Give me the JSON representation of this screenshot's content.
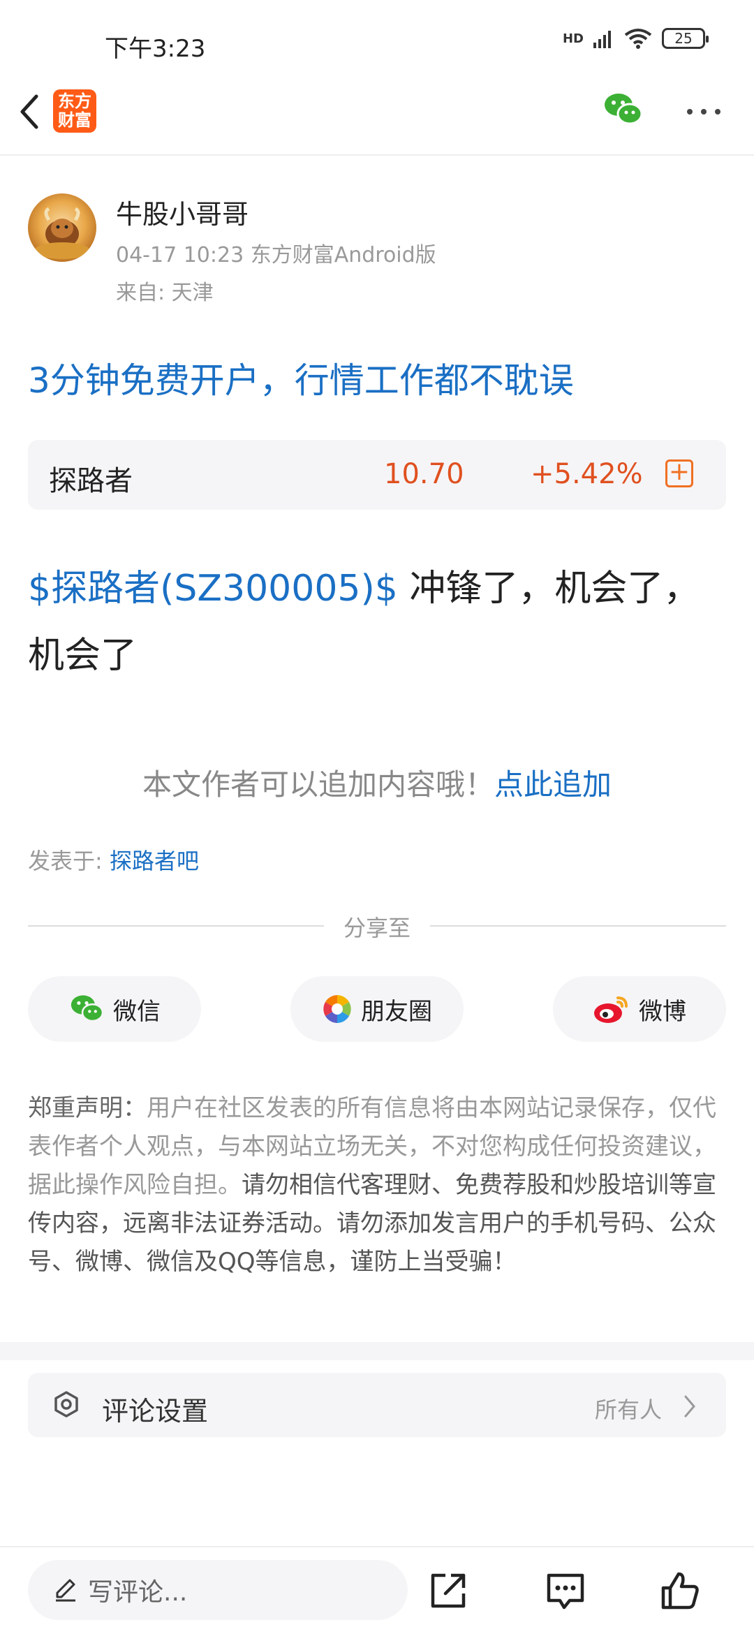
{
  "status_bar": {
    "time": "下午3:23",
    "network": "HD",
    "battery": "25"
  },
  "nav": {
    "logo_text": "东方财富"
  },
  "author": {
    "name": "牛股小哥哥",
    "meta": "04-17 10:23 东方财富Android版",
    "location": "来自: 天津"
  },
  "promo": {
    "text": "3分钟免费开户，行情工作都不耽误"
  },
  "stock_card": {
    "name": "探路者",
    "price": "10.70",
    "change": "+5.42%",
    "add_symbol": "+"
  },
  "post": {
    "tag": "$探路者(SZ300005)$",
    "text": " 冲锋了，机会了，机会了"
  },
  "append": {
    "prompt": "本文作者可以追加内容哦！",
    "link": "点此追加"
  },
  "posted_in": {
    "label": "发表于: ",
    "bar": "探路者吧"
  },
  "share": {
    "title": "分享至",
    "buttons": [
      {
        "label": "微信",
        "icon": "wechat-icon"
      },
      {
        "label": "朋友圈",
        "icon": "moments-icon"
      },
      {
        "label": "微博",
        "icon": "weibo-icon"
      }
    ]
  },
  "disclaimer": {
    "lead": "郑重声明：",
    "part1": "用户在社区发表的所有信息将由本网站记录保存，仅代表作者个人观点，与本网站立场无关，不对您构成任何投资建议，据此操作风险自担。",
    "part2": "请勿相信代客理财、免费荐股和炒股培训等宣传内容，远离非法证券活动。请勿添加发言用户的手机号码、公众号、微博、微信及QQ等信息，谨防上当受骗！"
  },
  "comment_settings": {
    "label": "评论设置",
    "value": "所有人"
  },
  "bottom_bar": {
    "input_placeholder": "写评论..."
  },
  "colors": {
    "link": "#1a6fc4",
    "rise": "#e0501f",
    "brand": "#ff5b17",
    "wechat": "#3cb034",
    "weibo": "#e6162d"
  }
}
